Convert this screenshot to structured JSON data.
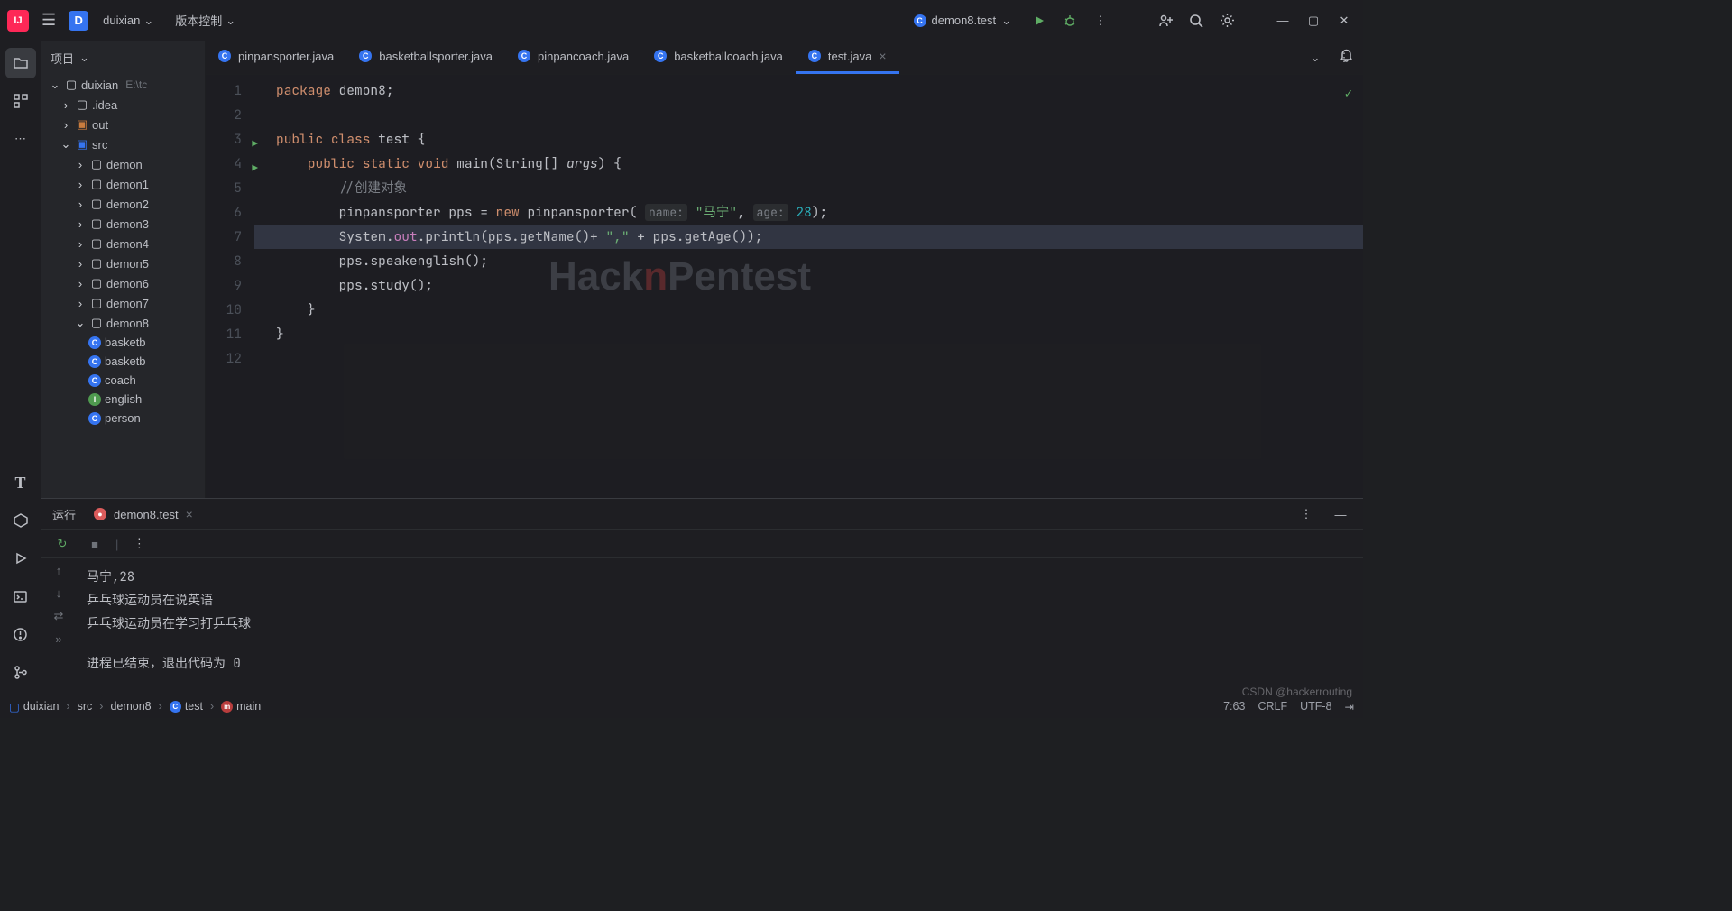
{
  "titlebar": {
    "project_name": "duixian",
    "vcs_label": "版本控制",
    "run_config": "demon8.test"
  },
  "panel": {
    "title": "项目"
  },
  "tree": {
    "root": "duixian",
    "root_path": "E:\\tc",
    "idea": ".idea",
    "out": "out",
    "src": "src",
    "demon": "demon",
    "demon1": "demon1",
    "demon2": "demon2",
    "demon3": "demon3",
    "demon4": "demon4",
    "demon5": "demon5",
    "demon6": "demon6",
    "demon7": "demon7",
    "demon8": "demon8",
    "basketb1": "basketb",
    "basketb2": "basketb",
    "coach": "coach",
    "english": "english",
    "person": "person"
  },
  "tabs": {
    "t1": "pinpansporter.java",
    "t2": "basketballsporter.java",
    "t3": "pinpancoach.java",
    "t4": "basketballcoach.java",
    "t5": "test.java"
  },
  "code": {
    "l1_package": "package",
    "l1_pkg": " demon8",
    "l3_public": "public ",
    "l3_class": "class ",
    "l3_name": "test ",
    "l4_public": "public ",
    "l4_static": "static ",
    "l4_void": "void ",
    "l4_main": "main",
    "l4_string": "String",
    "l4_args": "args",
    "l5_comment": "//创建对象",
    "l6_type": "pinpansporter ",
    "l6_var": "pps ",
    "l6_eq": "= ",
    "l6_new": "new ",
    "l6_ctor": "pinpansporter",
    "l6_hint1": "name:",
    "l6_str": "\"马宁\"",
    "l6_hint2": "age:",
    "l6_num": "28",
    "l7_sys": "System",
    "l7_out": "out",
    "l7_println": "println",
    "l7_getname": "getName",
    "l7_comma": "\",\"",
    "l7_getage": "getAge",
    "l8_speak": "speakenglish",
    "l9_study": "study"
  },
  "run": {
    "label": "运行",
    "tab": "demon8.test",
    "out1": "马宁,28",
    "out2": "乒乓球运动员在说英语",
    "out3": "乒乓球运动员在学习打乒乓球",
    "exit": "进程已结束，退出代码为 0"
  },
  "breadcrumb": {
    "b1": "duixian",
    "b2": "src",
    "b3": "demon8",
    "b4": "test",
    "b5": "main"
  },
  "status": {
    "pos": "7:63",
    "eol": "CRLF",
    "enc": "UTF-8",
    "csdn": "CSDN @hackerrouting"
  },
  "watermark": {
    "h": "Hack",
    "n": "n",
    "p": "Pentest"
  }
}
